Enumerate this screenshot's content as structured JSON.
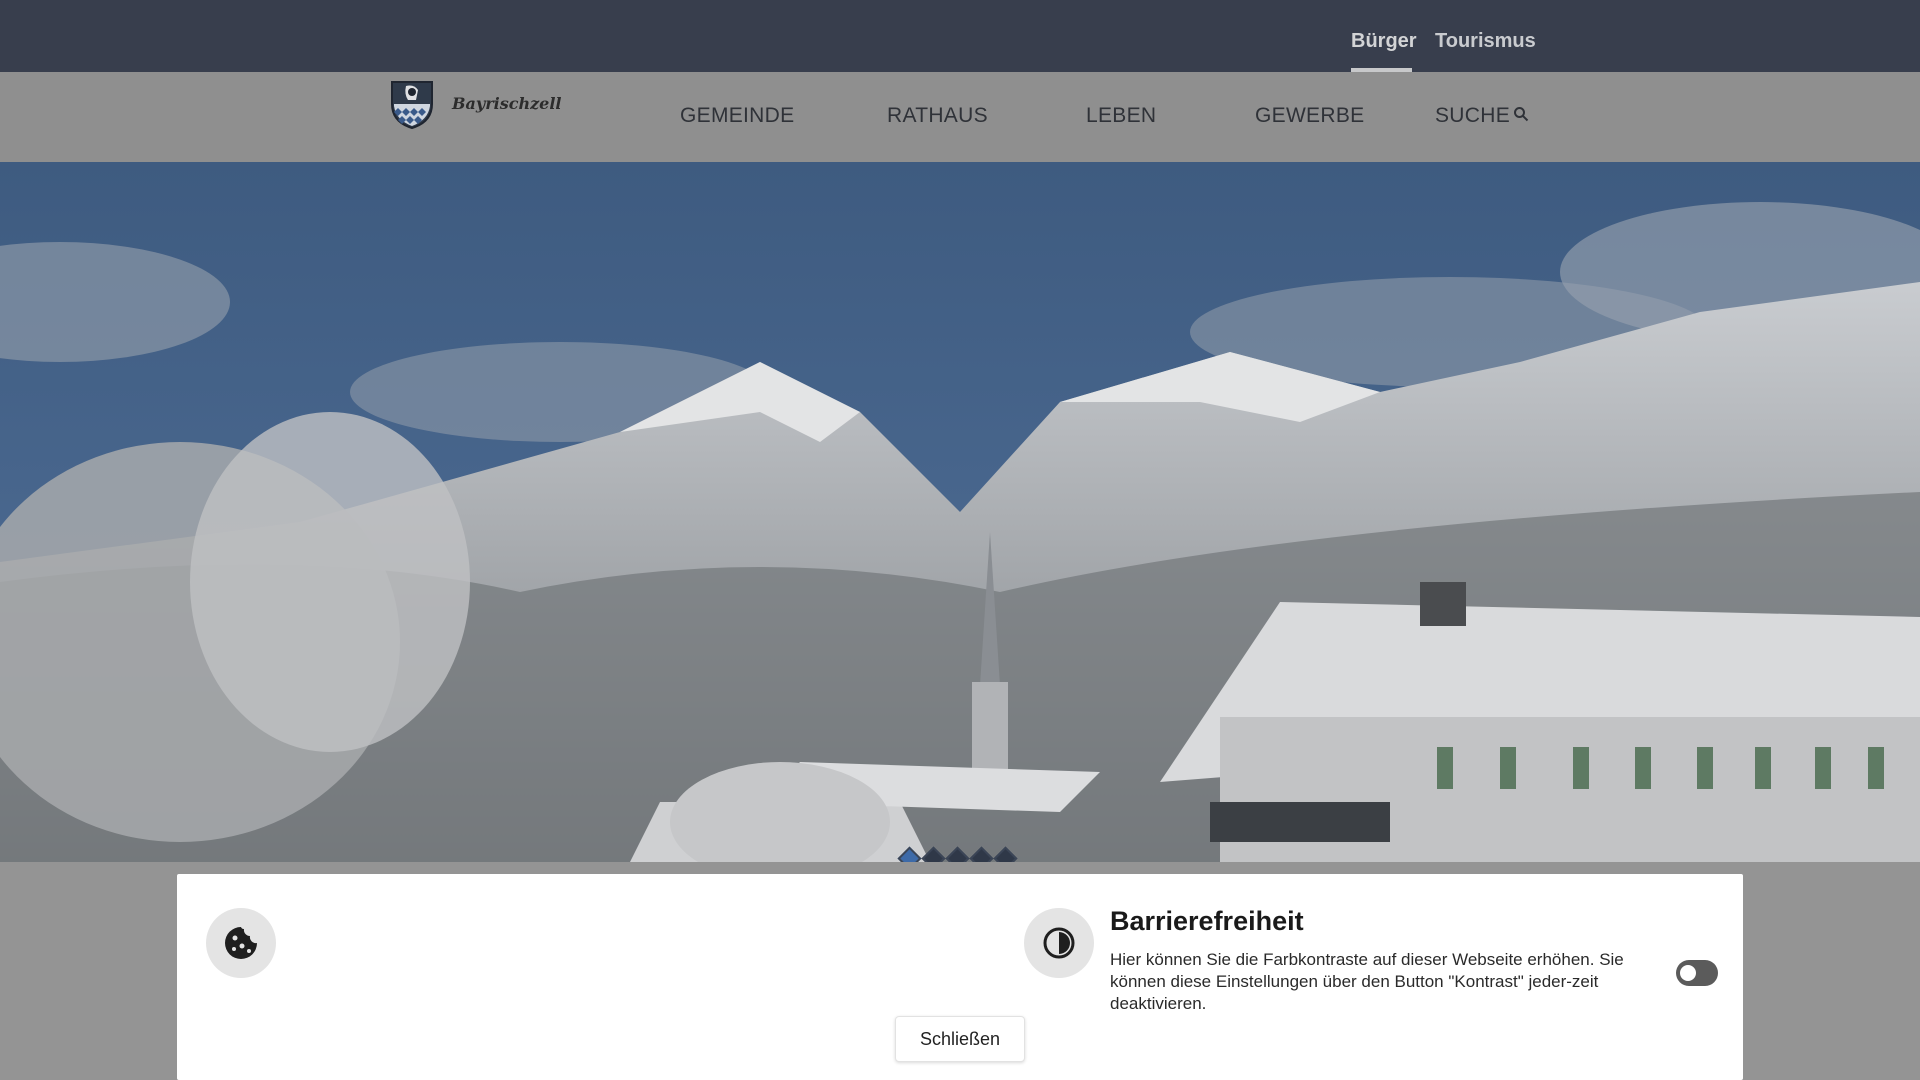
{
  "topbar": {
    "links": [
      {
        "label": "Bürger",
        "active": true
      },
      {
        "label": "Tourismus",
        "active": false
      }
    ]
  },
  "logo": {
    "text": "Bayrischzell",
    "icon": "coat-of-arms-icon"
  },
  "nav": {
    "items": [
      {
        "label": "GEMEINDE"
      },
      {
        "label": "RATHAUS"
      },
      {
        "label": "LEBEN"
      },
      {
        "label": "GEWERBE"
      },
      {
        "label": "SUCHE",
        "icon": "search-icon"
      }
    ]
  },
  "hero": {
    "slider_dots": 5,
    "active_dot": 1
  },
  "dialog": {
    "cookie_icon": "cookie-icon",
    "contrast_icon": "contrast-icon",
    "title": "Barrierefreiheit",
    "text": "Hier können Sie die Farbkontraste auf dieser Webseite erhöhen. Sie können diese Einstellungen über den Button \"Kontrast\" jeder-zeit deaktivieren.",
    "toggle_on": false,
    "close_label": "Schließen"
  },
  "colors": {
    "topbar": "#383e4d",
    "navbar": "#8f8f8f",
    "overlay": "#949494",
    "dialog": "#ffffff"
  }
}
